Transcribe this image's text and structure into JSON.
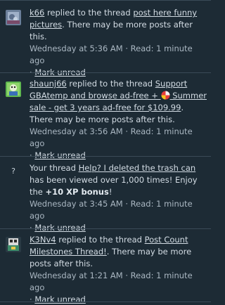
{
  "alerts": [
    {
      "user": "k66",
      "action": " replied to the thread ",
      "thread": "post here funny pictures",
      "suffix": ". There may be more posts after this.",
      "time": "Wednesday at 5:36 AM",
      "read": " · Read: 1 minute ago",
      "mark": "Mark unread"
    },
    {
      "user": "shaunj66",
      "action": " replied to the thread ",
      "thread_part1": "Support GBAtemp and browse ad-free + ",
      "thread_part2": " Summer sale - get 3 years ad-free for $109.99",
      "suffix": ". There may be more posts after this.",
      "time": "Wednesday at 3:56 AM",
      "read": " · Read: 1 minute ago",
      "mark": "Mark unread"
    },
    {
      "prefix": "Your thread ",
      "thread": "Help? I deleted the trash can",
      "middle": " has been viewed over 1,000 times! Enjoy the ",
      "bonus": "+10 XP bonus",
      "end": "!",
      "time": "Wednesday at 3:45 AM",
      "read": " · Read: 1 minute ago",
      "mark": "Mark unread",
      "icon_char": "?"
    },
    {
      "user": "K3Nv4",
      "action": " replied to the thread ",
      "thread": "Post Count Milestones Thread!",
      "suffix": ". There may be more posts after this.",
      "time": "Wednesday at 1:21 AM",
      "read": " · Read: 1 minute ago",
      "mark": "Mark unread"
    }
  ],
  "colors": {
    "background": "#1d2b35",
    "text": "#d3dce4",
    "separator": "#3a4a57"
  }
}
